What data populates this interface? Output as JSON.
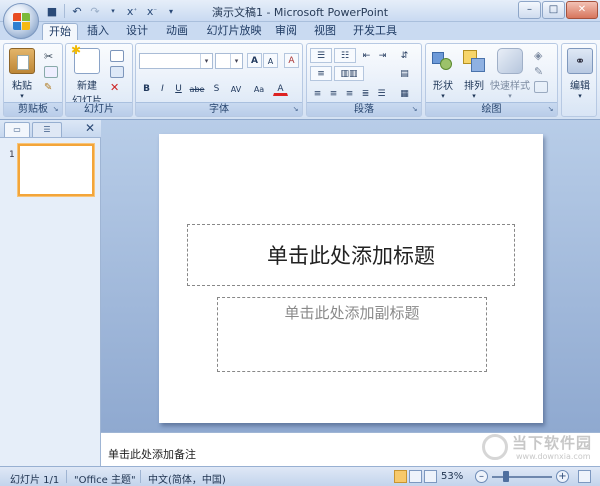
{
  "window": {
    "title": "演示文稿1 - Microsoft PowerPoint",
    "minimize": "–",
    "restore": "□",
    "close": "✕"
  },
  "qat": {
    "save": "💾",
    "undo": "↶",
    "redo": "↷",
    "format_x": "x⁻",
    "format_x2": "x⁻",
    "more": "⇣"
  },
  "tabs": [
    "开始",
    "插入",
    "设计",
    "动画",
    "幻灯片放映",
    "审阅",
    "视图",
    "开发工具"
  ],
  "ribbon": {
    "clipboard": {
      "label": "剪贴板",
      "paste": "粘贴"
    },
    "slides": {
      "label": "幻灯片",
      "new_slide": "新建",
      "new_slide2": "幻灯片"
    },
    "font": {
      "label": "字体",
      "bold": "B",
      "italic": "I",
      "underline": "U",
      "strike": "abe",
      "shadow": "S",
      "spacing": "AV",
      "case": "Aa",
      "grow": "A",
      "shrink": "A",
      "clear": "A"
    },
    "paragraph": {
      "label": "段落"
    },
    "drawing": {
      "label": "绘图",
      "shapes": "形状",
      "arrange": "排列",
      "quick_styles": "快速样式"
    },
    "editing": {
      "label": "编辑"
    }
  },
  "left_pane": {
    "close": "✕",
    "thumb_number": "1"
  },
  "slide": {
    "title_placeholder": "单击此处添加标题",
    "subtitle_placeholder": "单击此处添加副标题"
  },
  "notes": {
    "placeholder": "单击此处添加备注"
  },
  "status": {
    "slide_count": "幻灯片 1/1",
    "theme": "\"Office 主题\"",
    "language": "中文(简体，中国)",
    "zoom": "53%",
    "zoom_level": 0.53
  },
  "watermark": {
    "text": "当下软件园",
    "url": "www.downxia.com"
  },
  "colors": {
    "active_thumb": "#f3a53a",
    "ribbon_bg": "#e3ecf8",
    "workspace": "#9fb8dc"
  }
}
